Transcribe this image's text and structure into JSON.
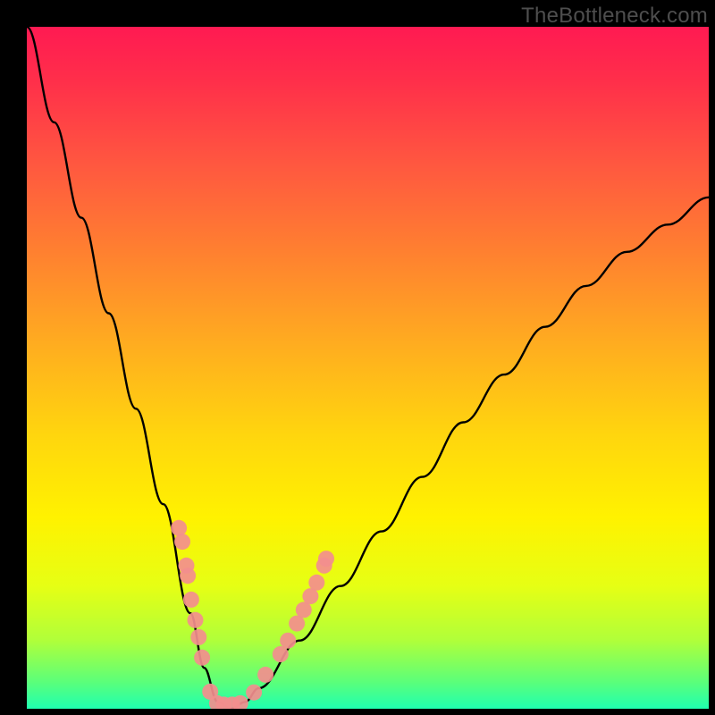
{
  "watermark": "TheBottleneck.com",
  "chart_data": {
    "type": "line",
    "title": "",
    "xlabel": "",
    "ylabel": "",
    "xlim": [
      0,
      100
    ],
    "ylim": [
      0,
      100
    ],
    "grid": false,
    "series": [
      {
        "name": "bottleneck-curve",
        "x": [
          0,
          4,
          8,
          12,
          16,
          20,
          24,
          26,
          28,
          30,
          32,
          34,
          40,
          46,
          52,
          58,
          64,
          70,
          76,
          82,
          88,
          94,
          100
        ],
        "y": [
          100,
          86,
          72,
          58,
          44,
          30,
          14,
          6,
          1,
          0,
          1,
          3,
          10,
          18,
          26,
          34,
          42,
          49,
          56,
          62,
          67,
          71,
          75
        ]
      }
    ],
    "markers": {
      "name": "highlight-points",
      "color": "#f38e8e",
      "radius_px": 9,
      "points": [
        {
          "x": 22.3,
          "y": 26.5
        },
        {
          "x": 22.8,
          "y": 24.5
        },
        {
          "x": 23.4,
          "y": 21.0
        },
        {
          "x": 23.6,
          "y": 19.5
        },
        {
          "x": 24.1,
          "y": 16.0
        },
        {
          "x": 24.7,
          "y": 13.0
        },
        {
          "x": 25.2,
          "y": 10.5
        },
        {
          "x": 25.7,
          "y": 7.5
        },
        {
          "x": 26.9,
          "y": 2.5
        },
        {
          "x": 27.9,
          "y": 0.8
        },
        {
          "x": 28.9,
          "y": 0.6
        },
        {
          "x": 30.1,
          "y": 0.6
        },
        {
          "x": 31.3,
          "y": 0.8
        },
        {
          "x": 33.3,
          "y": 2.4
        },
        {
          "x": 35.0,
          "y": 5.0
        },
        {
          "x": 37.2,
          "y": 8.0
        },
        {
          "x": 38.3,
          "y": 10.0
        },
        {
          "x": 39.6,
          "y": 12.5
        },
        {
          "x": 40.6,
          "y": 14.5
        },
        {
          "x": 41.6,
          "y": 16.5
        },
        {
          "x": 42.5,
          "y": 18.5
        },
        {
          "x": 43.6,
          "y": 21.0
        },
        {
          "x": 43.9,
          "y": 22.0
        }
      ]
    }
  }
}
